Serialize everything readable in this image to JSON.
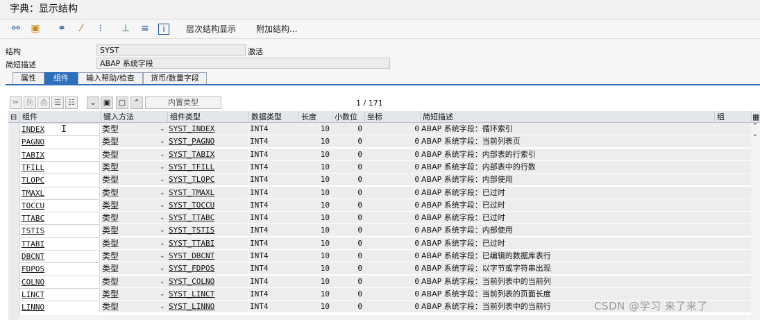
{
  "window": {
    "title": "字典：显示结构"
  },
  "toolbar": {
    "icons": [
      "glasses-icon",
      "transport-icon",
      "binoculars-icon",
      "magic-wand-icon",
      "tree-icon",
      "hierarchy-icon",
      "stack-icon",
      "info-icon"
    ],
    "hierarchy_label": "层次结构显示",
    "append_label": "附加结构..."
  },
  "form": {
    "structure_label": "结构",
    "structure_value": "SYST",
    "status": "激活",
    "short_desc_label": "简短描述",
    "short_desc_value": "ABAP 系统字段"
  },
  "tabs": [
    {
      "label": "属性"
    },
    {
      "label": "组件"
    },
    {
      "label": "输入帮助/检查"
    },
    {
      "label": "货币/数量字段"
    }
  ],
  "subtoolbar": {
    "inner_type_label": "内置类型",
    "counter": "1 / 171"
  },
  "table": {
    "headers": {
      "component": "组件",
      "entry": "键入方法",
      "comp_type": "组件类型",
      "data_type": "数据类型",
      "length": "长度",
      "decimals": "小数位",
      "coord": "坐标",
      "desc": "简短描述",
      "group": "组"
    },
    "rows": [
      {
        "name": "INDEX",
        "entry": "类型",
        "type": "SYST_INDEX",
        "dt": "INT4",
        "len": "10",
        "dec": "0",
        "coord": "0",
        "desc": "ABAP 系统字段：循环索引"
      },
      {
        "name": "PAGNO",
        "entry": "类型",
        "type": "SYST_PAGNO",
        "dt": "INT4",
        "len": "10",
        "dec": "0",
        "coord": "0",
        "desc": "ABAP 系统字段：当前列表页"
      },
      {
        "name": "TABIX",
        "entry": "类型",
        "type": "SYST_TABIX",
        "dt": "INT4",
        "len": "10",
        "dec": "0",
        "coord": "0",
        "desc": "ABAP 系统字段：内部表的行索引"
      },
      {
        "name": "TFILL",
        "entry": "类型",
        "type": "SYST_TFILL",
        "dt": "INT4",
        "len": "10",
        "dec": "0",
        "coord": "0",
        "desc": "ABAP 系统字段：内部表中的行数"
      },
      {
        "name": "TLOPC",
        "entry": "类型",
        "type": "SYST_TLOPC",
        "dt": "INT4",
        "len": "10",
        "dec": "0",
        "coord": "0",
        "desc": "ABAP 系统字段：内部使用"
      },
      {
        "name": "TMAXL",
        "entry": "类型",
        "type": "SYST_TMAXL",
        "dt": "INT4",
        "len": "10",
        "dec": "0",
        "coord": "0",
        "desc": "ABAP 系统字段：已过时"
      },
      {
        "name": "TOCCU",
        "entry": "类型",
        "type": "SYST_TOCCU",
        "dt": "INT4",
        "len": "10",
        "dec": "0",
        "coord": "0",
        "desc": "ABAP 系统字段：已过时"
      },
      {
        "name": "TTABC",
        "entry": "类型",
        "type": "SYST_TTABC",
        "dt": "INT4",
        "len": "10",
        "dec": "0",
        "coord": "0",
        "desc": "ABAP 系统字段：已过时"
      },
      {
        "name": "TSTIS",
        "entry": "类型",
        "type": "SYST_TSTIS",
        "dt": "INT4",
        "len": "10",
        "dec": "0",
        "coord": "0",
        "desc": "ABAP 系统字段：内部使用"
      },
      {
        "name": "TTABI",
        "entry": "类型",
        "type": "SYST_TTABI",
        "dt": "INT4",
        "len": "10",
        "dec": "0",
        "coord": "0",
        "desc": "ABAP 系统字段：已过时"
      },
      {
        "name": "DBCNT",
        "entry": "类型",
        "type": "SYST_DBCNT",
        "dt": "INT4",
        "len": "10",
        "dec": "0",
        "coord": "0",
        "desc": "ABAP 系统字段：已编辑的数据库表行"
      },
      {
        "name": "FDPOS",
        "entry": "类型",
        "type": "SYST_FDPOS",
        "dt": "INT4",
        "len": "10",
        "dec": "0",
        "coord": "0",
        "desc": "ABAP 系统字段：以字节或字符串出现"
      },
      {
        "name": "COLNO",
        "entry": "类型",
        "type": "SYST_COLNO",
        "dt": "INT4",
        "len": "10",
        "dec": "0",
        "coord": "0",
        "desc": "ABAP 系统字段：当前列表中的当前列"
      },
      {
        "name": "LINCT",
        "entry": "类型",
        "type": "SYST_LINCT",
        "dt": "INT4",
        "len": "10",
        "dec": "0",
        "coord": "0",
        "desc": "ABAP 系统字段：当前列表的页面长度"
      },
      {
        "name": "LINNO",
        "entry": "类型",
        "type": "SYST_LINNO",
        "dt": "INT4",
        "len": "10",
        "dec": "0",
        "coord": "0",
        "desc": "ABAP 系统字段：当前列表中的当前行"
      }
    ]
  },
  "watermark": "CSDN @学习 来了来了"
}
